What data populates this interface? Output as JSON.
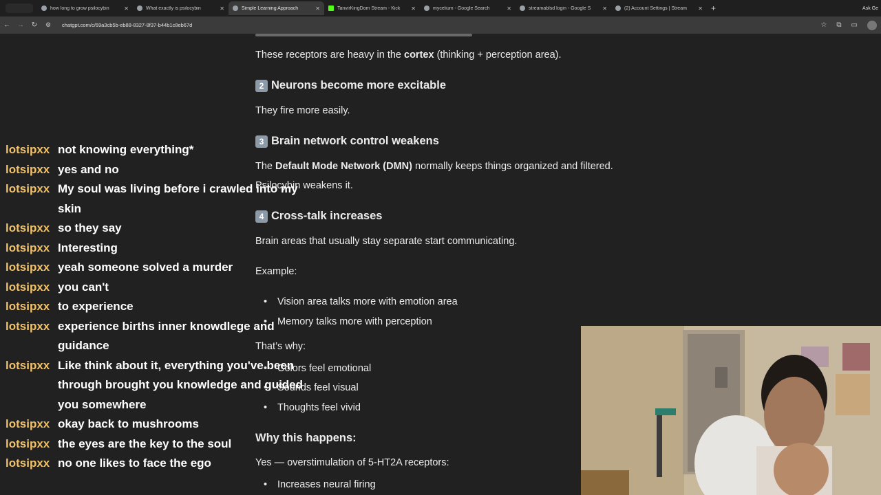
{
  "browser": {
    "tabs": [
      {
        "title": "how long to grow psilocybin"
      },
      {
        "title": "What exactly is psilocybin"
      },
      {
        "title": "Simple Learning Approach",
        "active": true
      },
      {
        "title": "TanvirKingDom Stream - Kick"
      },
      {
        "title": "mycelium - Google Search"
      },
      {
        "title": "streamablsd login - Google S"
      },
      {
        "title": "(2) Account Settings | Stream"
      }
    ],
    "new_tab": "+",
    "right_label": "Ask Ge",
    "url": "chatgpt.com/c/69a3cb5b-eb88-8327-8f37-b44b1c8eb67d"
  },
  "article": {
    "intro": {
      "pre": "These receptors are heavy in the ",
      "bold": "cortex",
      "post": " (thinking + perception area)."
    },
    "step2": {
      "num": "2",
      "title": "Neurons become more excitable",
      "body": "They fire more easily."
    },
    "step3": {
      "num": "3",
      "title": "Brain network control weakens",
      "pre": "The ",
      "bold": "Default Mode Network (DMN)",
      "post": " normally keeps things organized and filtered.",
      "body2": "Psilocybin weakens it."
    },
    "step4": {
      "num": "4",
      "title": "Cross-talk increases",
      "body": "Brain areas that usually stay separate start communicating."
    },
    "example_label": "Example:",
    "example_items": [
      "Vision area talks more with emotion area",
      "Memory talks more with perception"
    ],
    "thats_why": "That’s why:",
    "why_items": [
      "Colors feel emotional",
      "Sounds feel visual",
      "Thoughts feel vivid"
    ],
    "why_heading": "Why this happens:",
    "why_body": "Yes — overstimulation of 5-HT2A receptors:",
    "last_item": "Increases neural firing"
  },
  "chat": [
    {
      "user": "lotsipxx",
      "text": "not knowing everything*"
    },
    {
      "user": "lotsipxx",
      "text": "yes and no"
    },
    {
      "user": "lotsipxx",
      "text": "My soul was living before i crawled into my skin"
    },
    {
      "user": "lotsipxx",
      "text": "so they say"
    },
    {
      "user": "lotsipxx",
      "text": "Interesting"
    },
    {
      "user": "lotsipxx",
      "text": "yeah someone solved a murder"
    },
    {
      "user": "lotsipxx",
      "text": "you can't"
    },
    {
      "user": "lotsipxx",
      "text": "to experience"
    },
    {
      "user": "lotsipxx",
      "text": "experience births inner knowdlege and guidance"
    },
    {
      "user": "lotsipxx",
      "text": "Like think about it, everything you've been through brought you knowledge and guided you somewhere"
    },
    {
      "user": "lotsipxx",
      "text": "okay back to mushrooms"
    },
    {
      "user": "lotsipxx",
      "text": "the eyes are the key to the soul"
    },
    {
      "user": "lotsipxx",
      "text": "no one likes to face the ego"
    }
  ],
  "colors": {
    "chat_user": "#f2c26b",
    "background": "#212121",
    "step_badge": "#8c9aa8"
  },
  "icons": [
    "back-icon",
    "forward-icon",
    "reload-icon",
    "site-settings-icon",
    "bookmark-star-icon",
    "extensions-icon",
    "sidebar-icon",
    "profile-icon"
  ]
}
